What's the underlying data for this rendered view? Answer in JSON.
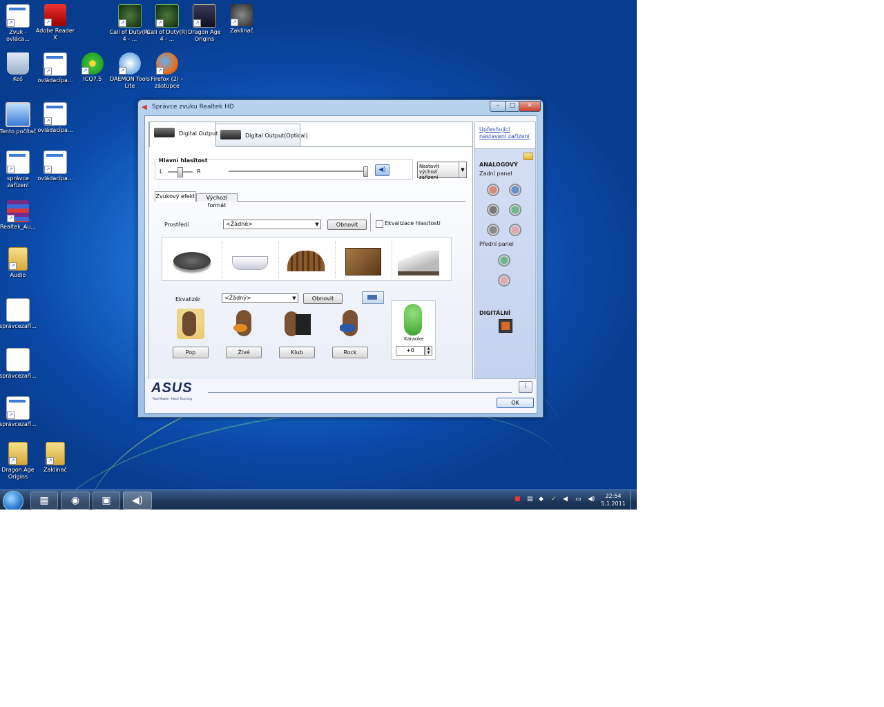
{
  "desktop_icons": [
    {
      "label": "Zvuk - ovláca...",
      "icon": "window-icon"
    },
    {
      "label": "Adobe Reader X",
      "icon": "pdf-icon"
    },
    {
      "label": "Call of Duty(R) 4 - ...",
      "icon": "cod-icon"
    },
    {
      "label": "Call of Duty(R) 4 - ...",
      "icon": "cod-icon"
    },
    {
      "label": "Dragon Age Origins",
      "icon": "dragon-age-icon"
    },
    {
      "label": "Zaklinač",
      "icon": "witcher-icon"
    },
    {
      "label": "Koš",
      "icon": "recycle-bin-icon"
    },
    {
      "label": "ovládacípa...",
      "icon": "window-icon"
    },
    {
      "label": "ICQ7.5",
      "icon": "icq-icon"
    },
    {
      "label": "DAEMON Tools Lite",
      "icon": "daemon-tools-icon"
    },
    {
      "label": "Firefox (2) – zástupce",
      "icon": "firefox-icon"
    },
    {
      "label": "Tento počítač",
      "icon": "computer-icon"
    },
    {
      "label": "ovládacípa...",
      "icon": "window-icon"
    },
    {
      "label": "správce zařízení",
      "icon": "window-icon"
    },
    {
      "label": "ovládacípa...",
      "icon": "window-icon"
    },
    {
      "label": "Realtek_Au...",
      "icon": "winrar-icon"
    },
    {
      "label": "Audio",
      "icon": "folder-icon"
    },
    {
      "label": "správcezaří...",
      "icon": "document-icon"
    },
    {
      "label": "správcezaří...",
      "icon": "document-icon"
    },
    {
      "label": "správcezaří...",
      "icon": "window-icon"
    },
    {
      "label": "Dragon Age Origins",
      "icon": "folder-icon"
    },
    {
      "label": "Zaklinač",
      "icon": "folder-icon"
    }
  ],
  "window": {
    "title": "Správce zvuku Realtek HD",
    "minimize": "–",
    "maximize": "□",
    "close": "✕"
  },
  "tabs": [
    {
      "label": "Digital Output"
    },
    {
      "label": "Digital Output(Optical)"
    }
  ],
  "volume": {
    "section_label": "Hlavní hlasitost",
    "left": "L",
    "right": "R",
    "balance": 0.5,
    "level": 1.0,
    "set_default_button": "Nastavit výchozí zařízení"
  },
  "subtabs": [
    {
      "label": "Zvukový efekt"
    },
    {
      "label": "Výchozí formát"
    }
  ],
  "environment": {
    "label": "Prostředí",
    "selected": "<Žádné>",
    "reset_button": "Obnovit",
    "loudness_label": "Ekvalizace hlasitosti",
    "presets": [
      {
        "icon": "stone-disc-icon"
      },
      {
        "icon": "bathtub-icon"
      },
      {
        "icon": "colosseum-icon"
      },
      {
        "icon": "wooden-room-icon"
      },
      {
        "icon": "opera-house-icon"
      }
    ]
  },
  "equalizer": {
    "label": "Ekvalizér",
    "selected": "<Žádný>",
    "reset_button": "Obnovit",
    "presets": [
      {
        "label": "Pop",
        "icon": "pop-singer-icon"
      },
      {
        "label": "Živé",
        "icon": "guitarist-icon"
      },
      {
        "label": "Klub",
        "icon": "pianist-icon"
      },
      {
        "label": "Rock",
        "icon": "rock-guitarist-icon"
      }
    ],
    "karaoke_label": "Karaoke",
    "karaoke_value": "+0"
  },
  "side_panel": {
    "advanced_link": "Upřesňující nastavení zařízení",
    "analog_title": "ANALOGOVÝ",
    "back_panel": "Zadní panel",
    "front_panel": "Přední panel",
    "digital_title": "DIGITÁLNÍ",
    "back_jacks": [
      "#d98a7a",
      "#6a8ed0",
      "#7a7a7a",
      "#6fb88f",
      "#8a8a8a",
      "#e0a8b4"
    ],
    "front_jacks": [
      "#6fb88f",
      "#e0a8b4"
    ]
  },
  "footer": {
    "brand": "ASUS",
    "tagline": "Real Mobile · Heart Touching",
    "ok_button": "OK",
    "info_button": "i"
  },
  "taskbar": {
    "clock_time": "22:54",
    "clock_date": "5.1.2011"
  }
}
